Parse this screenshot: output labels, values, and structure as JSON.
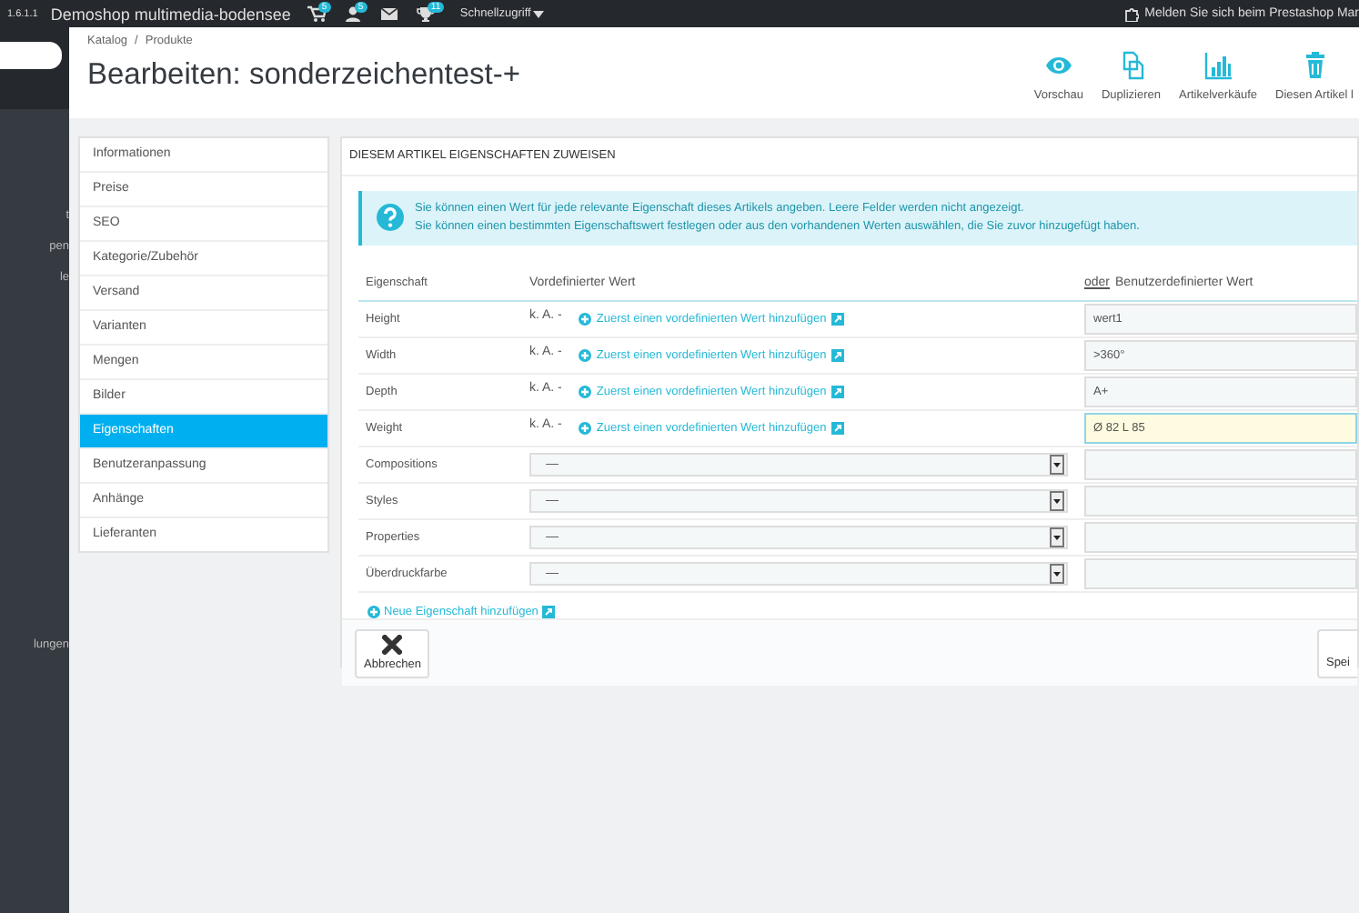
{
  "top_bar": {
    "version": "1.6.1.1",
    "shop_name": "Demoshop multimedia-bodensee",
    "icons": [
      {
        "kind": "cart",
        "badge": "5"
      },
      {
        "kind": "user",
        "badge": "5"
      },
      {
        "kind": "mail"
      },
      {
        "kind": "trophy",
        "badge": "11"
      }
    ],
    "quick_access": "Schnellzugriff",
    "notice": "Melden Sie sich beim Prestashop Mar"
  },
  "sidebar": {
    "items": [
      "t",
      "pen",
      "le",
      "lungen"
    ]
  },
  "header": {
    "breadcrumb": [
      "Katalog",
      "Produkte"
    ],
    "breadcrumb_separator": "/",
    "title": "Bearbeiten: sonderzeichentest-+",
    "toolbar": [
      {
        "kind": "preview",
        "label": "Vorschau"
      },
      {
        "kind": "duplicate",
        "label": "Duplizieren"
      },
      {
        "kind": "sales",
        "label": "Artikelverkäufe"
      },
      {
        "kind": "delete",
        "label": "Diesen Artikel l"
      }
    ]
  },
  "tabs": [
    {
      "label": "Informationen",
      "selected": false
    },
    {
      "label": "Preise",
      "selected": false
    },
    {
      "label": "SEO",
      "selected": false
    },
    {
      "label": "Kategorie/Zubehör",
      "selected": false
    },
    {
      "label": "Versand",
      "selected": false
    },
    {
      "label": "Varianten",
      "selected": false
    },
    {
      "label": "Mengen",
      "selected": false
    },
    {
      "label": "Bilder",
      "selected": false
    },
    {
      "label": "Eigenschaften",
      "selected": true
    },
    {
      "label": "Benutzeranpassung",
      "selected": false
    },
    {
      "label": "Anhänge",
      "selected": false
    },
    {
      "label": "Lieferanten",
      "selected": false
    }
  ],
  "panel": {
    "heading": "DIESEM ARTIKEL EIGENSCHAFTEN ZUWEISEN",
    "info": [
      "Sie können einen Wert für jede relevante Eigenschaft dieses Artikels angeben. Leere Felder werden nicht angezeigt.",
      "Sie können einen bestimmten Eigenschaftswert festlegen oder aus den vorhandenen Werten auswählen, die Sie zuvor hinzugefügt haben."
    ],
    "columns": {
      "feature": "Eigenschaft",
      "predefined": "Vordefinierter Wert",
      "custom_prefix": "oder",
      "custom": "Benutzerdefinierter Wert"
    },
    "rows": [
      {
        "name": "Height",
        "kind": "none",
        "none_label": "k. A. -",
        "link": "Zuerst einen vordefinierten Wert hinzufügen",
        "value": "wert1",
        "focused": false
      },
      {
        "name": "Width",
        "kind": "none",
        "none_label": "k. A. -",
        "link": "Zuerst einen vordefinierten Wert hinzufügen",
        "value": ">360°",
        "focused": false
      },
      {
        "name": "Depth",
        "kind": "none",
        "none_label": "k. A. -",
        "link": "Zuerst einen vordefinierten Wert hinzufügen",
        "value": "A+",
        "focused": false
      },
      {
        "name": "Weight",
        "kind": "none",
        "none_label": "k. A. -",
        "link": "Zuerst einen vordefinierten Wert hinzufügen",
        "value": "Ø 82 L 85",
        "focused": true
      },
      {
        "name": "Compositions",
        "kind": "select",
        "option": "—",
        "focused": false
      },
      {
        "name": "Styles",
        "kind": "select",
        "option": "—",
        "focused": false
      },
      {
        "name": "Properties",
        "kind": "select",
        "option": "—",
        "focused": false
      },
      {
        "name": "Überdruckfarbe",
        "kind": "select",
        "option": "—",
        "focused": false
      }
    ],
    "add_link": "Neue Eigenschaft hinzufügen",
    "cancel": "Abbrechen",
    "save": "Spei"
  }
}
